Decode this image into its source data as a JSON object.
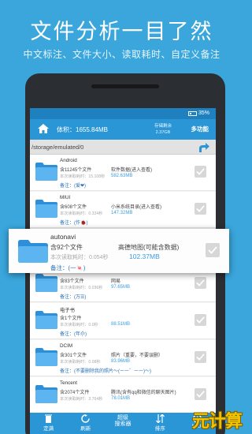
{
  "promo": {
    "title": "文件分析一目了然",
    "subtitle": "中文标注、文件大小、读取耗时、自定义备注"
  },
  "statusbar": {
    "battery": "35%"
  },
  "header": {
    "volume": "体积：1655.84MB",
    "storage_label": "存储剩余",
    "storage_value": "2.37GB",
    "more_label": "多功能"
  },
  "path": "/storage/emulated/0",
  "rows": [
    {
      "name": "Android",
      "count": "含11245个文件",
      "desc": "软件数据(进入查看)",
      "time": "本次读取耗时：15.108秒",
      "size": "582.63MB",
      "note": "备注：(爱❤)"
    },
    {
      "name": "MIUI",
      "count": "含608个文件",
      "desc": "小米系统目录(进入查看)",
      "time": "本次读取耗时：0.334秒",
      "size": "147.32MB",
      "note": "备注：(作🐞)"
    },
    {
      "name": "",
      "count": "",
      "desc": "",
      "time": "",
      "size": "",
      "note": ""
    },
    {
      "name": "",
      "count": "含83个文件",
      "desc": "网易",
      "time": "本次读取耗时：0.036秒",
      "size": "97.65MB",
      "note": "备注：(万☰)"
    },
    {
      "name": "电子书",
      "count": "含1个文件",
      "desc": "",
      "time": "本次读取耗时：0.0秒",
      "size": "88.51MB",
      "note": "备注：(年尒)"
    },
    {
      "name": "DCIM",
      "count": "含301个文件",
      "desc": "照片（重要，不要误删）",
      "time": "本次读取耗时：0.08秒",
      "size": "83.96MB",
      "note": "备注：(不要删除我的照片～(ーー゛ーー)～)"
    },
    {
      "name": "Tencent",
      "count": "含2074个文件",
      "desc": "腾讯(含有qq和微信的聊天图片)",
      "time": "本次读取耗时：3.764秒",
      "size": "78.01MB",
      "note": ""
    },
    {
      "name": "MiMarket",
      "count": "",
      "desc": "",
      "time": "",
      "size": "",
      "note": ""
    }
  ],
  "popup": {
    "name": "autonavi",
    "count": "含92个文件",
    "desc": "高德地图(可能含数据)",
    "time": "本次读取耗时：0.054秒",
    "size": "102.37MB",
    "note": "备注：(一🍬)"
  },
  "nav": [
    {
      "label": "定满",
      "icon": "delete-icon"
    },
    {
      "label": "刷新",
      "icon": "refresh-icon"
    },
    {
      "label1": "超级",
      "label2": "搜索器"
    },
    {
      "label": "排序",
      "icon": "sort-icon"
    },
    {
      "label": "MiUI",
      "icon": "info-icon"
    }
  ],
  "watermark": "元计算",
  "colors": {
    "brand": "#2a96d6",
    "background": "#3aa6dc",
    "size_text": "#3a9de0",
    "note_text": "#2b72b7"
  }
}
